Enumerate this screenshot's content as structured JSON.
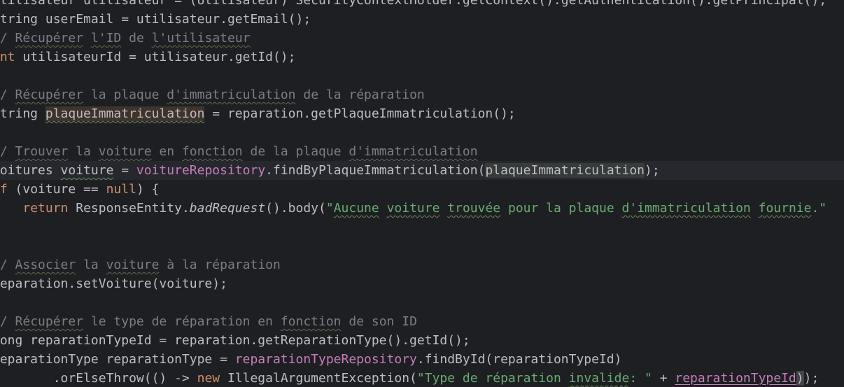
{
  "editor": {
    "lines": [
      {
        "row": 0,
        "tokens": [
          {
            "text": "Utilisateur utilisateur = (Utilisateur) SecurityContextHolder.getContext().getAuthentication().getPrincipal();",
            "cls": "c-plain"
          }
        ]
      },
      {
        "row": 1,
        "tokens": [
          {
            "text": "String userEmail = utilisateur.getEmail();",
            "cls": "c-plain"
          }
        ]
      },
      {
        "row": 2,
        "tokens": [
          {
            "text": "// ",
            "cls": "c-comment"
          },
          {
            "text": "Récupérer",
            "cls": "c-comment typo-c"
          },
          {
            "text": " ",
            "cls": "c-comment"
          },
          {
            "text": "l'ID",
            "cls": "c-comment typo-c"
          },
          {
            "text": " de ",
            "cls": "c-comment"
          },
          {
            "text": "l'utilisateur",
            "cls": "c-comment typo-c"
          }
        ]
      },
      {
        "row": 3,
        "tokens": [
          {
            "text": "int",
            "cls": "c-kw"
          },
          {
            "text": " utilisateurId = utilisateur.getId();",
            "cls": "c-plain"
          }
        ]
      },
      {
        "row": 5,
        "tokens": [
          {
            "text": "// ",
            "cls": "c-comment"
          },
          {
            "text": "Récupérer",
            "cls": "c-comment typo-c"
          },
          {
            "text": " la plaque ",
            "cls": "c-comment"
          },
          {
            "text": "d'immatriculation",
            "cls": "c-comment typo-c"
          },
          {
            "text": " de la réparation",
            "cls": "c-comment"
          }
        ]
      },
      {
        "row": 6,
        "tokens": [
          {
            "text": "String ",
            "cls": "c-plain"
          },
          {
            "text": "plaqueImmatriculation",
            "cls": "c-plain hl-write typo"
          },
          {
            "text": " = reparation.getPlaqueImmatriculation();",
            "cls": "c-plain"
          }
        ]
      },
      {
        "row": 8,
        "tokens": [
          {
            "text": "// ",
            "cls": "c-comment"
          },
          {
            "text": "Trouver",
            "cls": "c-comment typo-c"
          },
          {
            "text": " la ",
            "cls": "c-comment"
          },
          {
            "text": "voiture",
            "cls": "c-comment typo-c"
          },
          {
            "text": " en ",
            "cls": "c-comment"
          },
          {
            "text": "fonction",
            "cls": "c-comment typo-c"
          },
          {
            "text": " de la plaque ",
            "cls": "c-comment"
          },
          {
            "text": "d'immatriculation",
            "cls": "c-comment typo-c"
          }
        ]
      },
      {
        "row": 9,
        "caret": true,
        "tokens": [
          {
            "text": "Voitures ",
            "cls": "c-plain"
          },
          {
            "text": "voiture",
            "cls": "c-plain typo"
          },
          {
            "text": " = ",
            "cls": "c-plain"
          },
          {
            "text": "voitureRepository",
            "cls": "c-field"
          },
          {
            "text": ".findByPlaqueImmatriculation(",
            "cls": "c-plain"
          },
          {
            "text": "plaqueImmatriculation",
            "cls": "c-plain hl-read"
          },
          {
            "text": ");",
            "cls": "c-plain"
          }
        ]
      },
      {
        "row": 10,
        "tokens": [
          {
            "text": "if",
            "cls": "c-kw"
          },
          {
            "text": " (voiture == ",
            "cls": "c-plain"
          },
          {
            "text": "null",
            "cls": "c-kw"
          },
          {
            "text": ") {",
            "cls": "c-plain"
          }
        ]
      },
      {
        "row": 11,
        "tokens": [
          {
            "text": "    ",
            "cls": "c-plain"
          },
          {
            "text": "return",
            "cls": "c-kw"
          },
          {
            "text": " ResponseEntity.",
            "cls": "c-plain"
          },
          {
            "text": "badRequest",
            "cls": "c-plain c-italic"
          },
          {
            "text": "().body(",
            "cls": "c-plain"
          },
          {
            "text": "\"",
            "cls": "c-str"
          },
          {
            "text": "Aucune",
            "cls": "c-str typo"
          },
          {
            "text": " ",
            "cls": "c-str"
          },
          {
            "text": "voiture",
            "cls": "c-str typo"
          },
          {
            "text": " ",
            "cls": "c-str"
          },
          {
            "text": "trouvée",
            "cls": "c-str typo"
          },
          {
            "text": " pour la plaque ",
            "cls": "c-str"
          },
          {
            "text": "d'immatriculation",
            "cls": "c-str typo"
          },
          {
            "text": " ",
            "cls": "c-str"
          },
          {
            "text": "fournie",
            "cls": "c-str typo"
          },
          {
            "text": ".\"",
            "cls": "c-str"
          }
        ]
      },
      {
        "row": 12,
        "tokens": [
          {
            "text": "}",
            "cls": "c-plain"
          }
        ]
      },
      {
        "row": 14,
        "tokens": [
          {
            "text": "// ",
            "cls": "c-comment"
          },
          {
            "text": "Associer",
            "cls": "c-comment typo-c"
          },
          {
            "text": " la ",
            "cls": "c-comment"
          },
          {
            "text": "voiture",
            "cls": "c-comment typo-c"
          },
          {
            "text": " à la réparation",
            "cls": "c-comment"
          }
        ]
      },
      {
        "row": 15,
        "tokens": [
          {
            "text": "reparation.setVoiture(voiture);",
            "cls": "c-plain"
          }
        ]
      },
      {
        "row": 17,
        "tokens": [
          {
            "text": "// ",
            "cls": "c-comment"
          },
          {
            "text": "Récupérer",
            "cls": "c-comment typo-c"
          },
          {
            "text": " le type de réparation en ",
            "cls": "c-comment"
          },
          {
            "text": "fonction",
            "cls": "c-comment typo-c"
          },
          {
            "text": " de son ID",
            "cls": "c-comment"
          }
        ]
      },
      {
        "row": 18,
        "tokens": [
          {
            "text": "Long reparationTypeId = reparation.getReparationType().getId();",
            "cls": "c-plain"
          }
        ]
      },
      {
        "row": 19,
        "tokens": [
          {
            "text": "ReparationType reparationType = ",
            "cls": "c-plain"
          },
          {
            "text": "reparationTypeRepository",
            "cls": "c-field"
          },
          {
            "text": ".findById(reparationTypeId)",
            "cls": "c-plain"
          }
        ]
      },
      {
        "row": 20,
        "tokens": [
          {
            "text": "        .orElseThrow(() -> ",
            "cls": "c-plain"
          },
          {
            "text": "new",
            "cls": "c-kw"
          },
          {
            "text": " IllegalArgumentException(",
            "cls": "c-plain"
          },
          {
            "text": "\"Type de réparation ",
            "cls": "c-str"
          },
          {
            "text": "invalide",
            "cls": "c-str typo"
          },
          {
            "text": ": \"",
            "cls": "c-str"
          },
          {
            "text": " + ",
            "cls": "c-plain"
          },
          {
            "text": "reparationTypeId",
            "cls": "c-field uline"
          },
          {
            "text": ")",
            "cls": "c-plain paren-match"
          },
          {
            "text": ");",
            "cls": "c-plain"
          }
        ]
      }
    ]
  }
}
